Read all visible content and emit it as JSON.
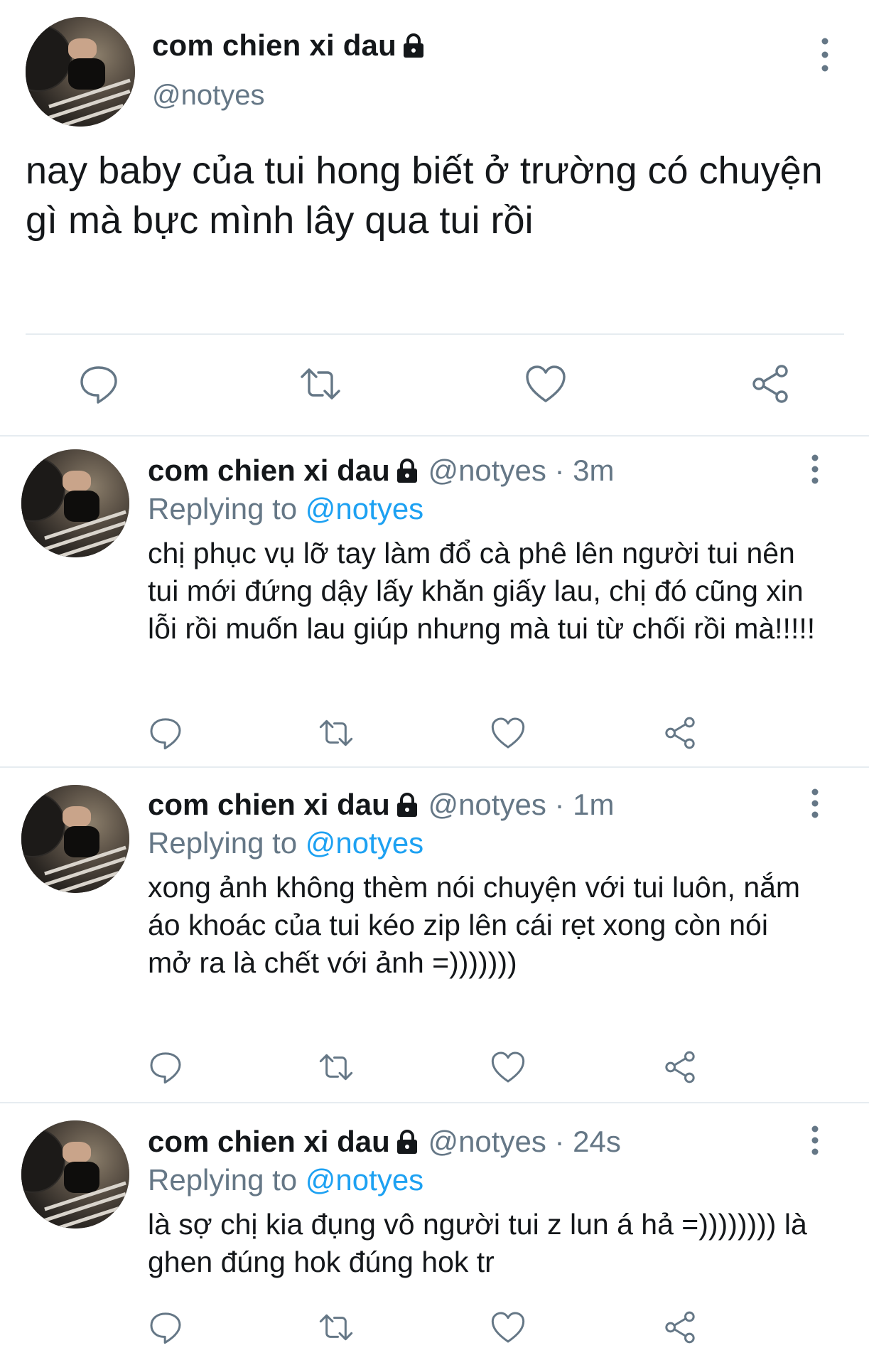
{
  "main_tweet": {
    "author_name": "com chien xi dau",
    "handle": "@notyes",
    "text": "nay baby của tui hong biết ở trường có chuyện gì mà bực mình lây qua tui rồi",
    "icons": [
      "reply-icon",
      "retweet-icon",
      "like-icon",
      "share-icon",
      "more-icon",
      "lock-icon"
    ]
  },
  "replies": [
    {
      "author_name": "com chien xi dau",
      "handle": "@notyes",
      "time": "· 3m",
      "replying_prefix": "Replying to",
      "replying_to": "@notyes",
      "text": "chị phục vụ lỡ tay làm đổ cà phê lên người tui nên tui mới đứng dậy lấy khăn giấy lau, chị đó cũng xin lỗi rồi muốn lau giúp nhưng mà tui từ chối rồi mà!!!!!"
    },
    {
      "author_name": "com chien xi dau",
      "handle": "@notyes",
      "time": "· 1m",
      "replying_prefix": "Replying to",
      "replying_to": "@notyes",
      "text": "xong ảnh không thèm nói chuyện với tui luôn, nắm áo khoác của tui kéo zip lên cái rẹt xong còn nói mở ra là chết với ảnh =)))))))"
    },
    {
      "author_name": "com chien xi dau",
      "handle": "@notyes",
      "time": "· 24s",
      "replying_prefix": "Replying to",
      "replying_to": "@notyes",
      "text": "là sợ chị kia đụng vô người tui z lun á hả =)))))))) là ghen đúng hok đúng hok tr"
    }
  ],
  "colors": {
    "text": "#14171a",
    "secondary": "#657786",
    "accent": "#1da1f2",
    "divider": "#e6ecf0"
  }
}
